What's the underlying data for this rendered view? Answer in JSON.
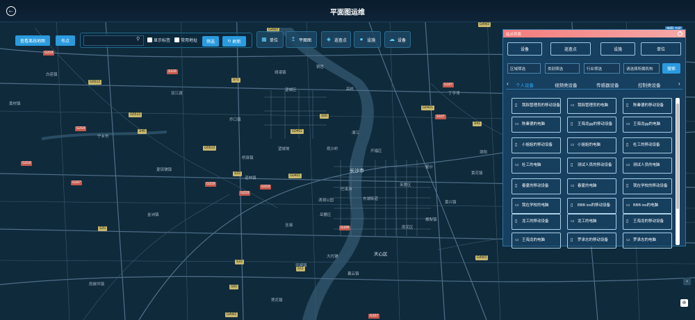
{
  "header": {
    "title": "平面图运维",
    "back_icon": "arrow-left-icon"
  },
  "toolbar": {
    "offline_btn": "查看离线地图",
    "point_btn": "布点",
    "search_placeholder": "",
    "show_label": "显示标签",
    "common_address": "常用地址",
    "filter_btn": "筛选",
    "refresh_btn": "刷新",
    "tools": [
      {
        "label": "单位",
        "icon": "building-icon"
      },
      {
        "label": "平面图",
        "icon": "upload-icon"
      },
      {
        "label": "巡查点",
        "icon": "inspect-point-icon"
      },
      {
        "label": "设施",
        "icon": "person-icon"
      },
      {
        "label": "设备",
        "icon": "device-icon"
      }
    ]
  },
  "map": {
    "pill": "地图 卫星",
    "labels": [
      "长沙市",
      "天心区",
      "开福区",
      "芙蓉区",
      "雨花区",
      "岳麓区",
      "望城区",
      "宁乡市",
      "双江湖",
      "湘江",
      "潇湘公园",
      "巴溪洲",
      "黄兴镇",
      "望城坡",
      "观沙岭",
      "东湖街道",
      "高岭",
      "星沙",
      "洞阳",
      "黄花镇",
      "榔梨镇",
      "暮云镇",
      "大托铺",
      "坪塘镇",
      "含浦",
      "莲花镇",
      "雨敞坪镇",
      "白若镇",
      "金洲镇",
      "黄材镇",
      "夏铎铺镇",
      "道林镇",
      "桥驿镇",
      "丁字湾",
      "铜官",
      "靖港镇",
      "乔口镇"
    ],
    "shields_y": [
      "G4W2",
      "G5513",
      "S71",
      "G0401",
      "G5513",
      "S22",
      "G5513",
      "G4W2",
      "S40",
      "G0401",
      "S22",
      "S20",
      "S11",
      "S41",
      "S50",
      "G0421",
      "G4W3",
      "S50",
      "G4W2"
    ],
    "shields_r": [
      "G319",
      "G107",
      "G319",
      "G319",
      "G319",
      "S107",
      "G107",
      "G319",
      "G106",
      "G107",
      "G319",
      "S103"
    ]
  },
  "panel": {
    "title": "站点列表",
    "categories": [
      "设备",
      "巡查点",
      "设施",
      "单位"
    ],
    "filters": [
      "区域筛选",
      "类别筛选",
      "行业筛选",
      "请选择所属机构"
    ],
    "search_btn": "搜索",
    "tabs": [
      "个人设备",
      "视频类设备",
      "传感器设备",
      "控制类设备"
    ],
    "devices": [
      {
        "label": "我拟管理员的移动设备",
        "icon": "phone-icon"
      },
      {
        "label": "我拟管理员的电脑",
        "icon": "monitor-icon"
      },
      {
        "label": "陈秦德的移动设备",
        "icon": "phone-icon"
      },
      {
        "label": "陈秦德的电脑",
        "icon": "monitor-icon"
      },
      {
        "label": "王海龙gg的移动设备",
        "icon": "phone-icon"
      },
      {
        "label": "王海龙gg的电脑",
        "icon": "monitor-icon"
      },
      {
        "label": "小姐姐的移动设备",
        "icon": "phone-icon"
      },
      {
        "label": "小姐姐的电脑",
        "icon": "monitor-icon"
      },
      {
        "label": "杜工的移动设备",
        "icon": "phone-icon"
      },
      {
        "label": "杜工的电脑",
        "icon": "monitor-icon"
      },
      {
        "label": "测试人员的移动设备",
        "icon": "phone-icon"
      },
      {
        "label": "测试人员的电脑",
        "icon": "monitor-icon"
      },
      {
        "label": "春夏的移动设备",
        "icon": "phone-icon"
      },
      {
        "label": "春夏的电脑",
        "icon": "monitor-icon"
      },
      {
        "label": "我在学校的移动设备",
        "icon": "phone-icon"
      },
      {
        "label": "我在学校的电脑",
        "icon": "monitor-icon"
      },
      {
        "label": "BBB ios的移动设备",
        "icon": "phone-icon"
      },
      {
        "label": "BBB ios的电脑",
        "icon": "monitor-icon"
      },
      {
        "label": "龙工的移动设备",
        "icon": "phone-icon"
      },
      {
        "label": "龙工的电脑",
        "icon": "monitor-icon"
      },
      {
        "label": "王海龙的移动设备",
        "icon": "phone-icon"
      },
      {
        "label": "王海龙的电脑",
        "icon": "monitor-icon"
      },
      {
        "label": "罗承志的移动设备",
        "icon": "phone-icon"
      },
      {
        "label": "罗承志的电脑",
        "icon": "monitor-icon"
      }
    ]
  }
}
